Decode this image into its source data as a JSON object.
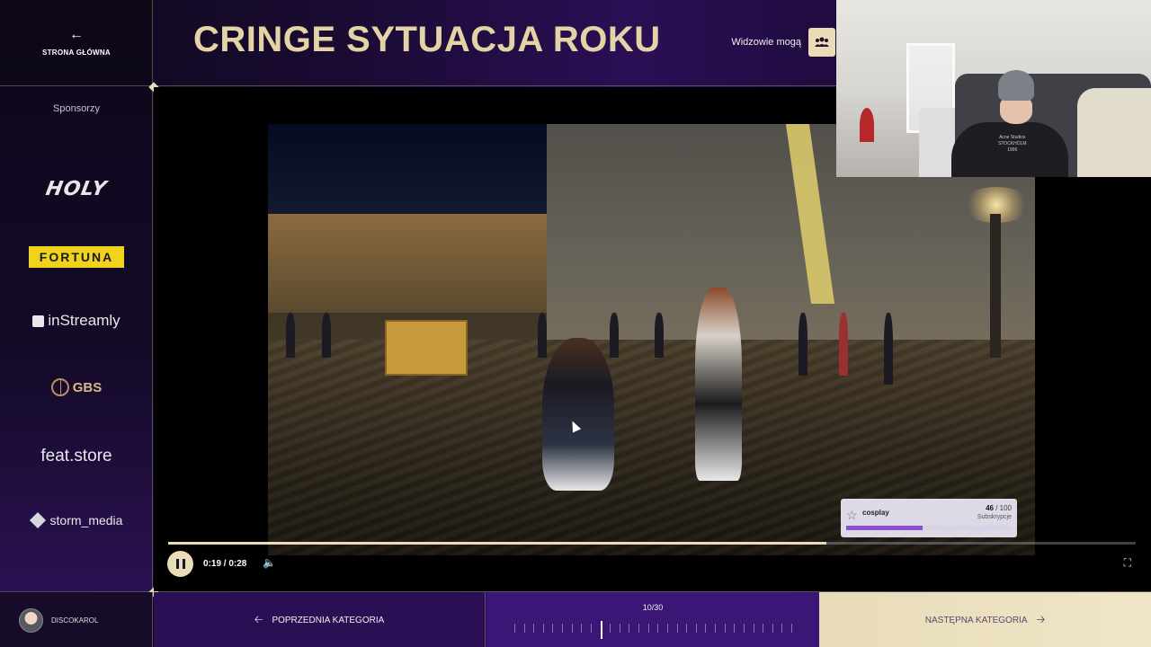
{
  "sidebar": {
    "home_label": "STRONA GŁÓWNA",
    "sponsors_title": "Sponsorzy",
    "sponsors": [
      "HOLY",
      "FORTUNA",
      "inStreamly",
      "GBS",
      "feat.store",
      "storm_media"
    ]
  },
  "header": {
    "title": "CRINGE SYTUACJA ROKU",
    "viewers_label": "Widzowie mogą"
  },
  "player": {
    "time": "0:19 / 0:28",
    "progress": 0.68
  },
  "sub_widget": {
    "name": "cosplay",
    "count": "46",
    "total": "/ 100",
    "label": "Subskrypcje",
    "progress": 0.46
  },
  "webcam": {
    "shirt_text": [
      "Acne Studios",
      "STOCKHOLM",
      "1996"
    ]
  },
  "bottom": {
    "username": "DISCOKAROL",
    "prev_label": "POPRZEDNIA KATEGORIA",
    "next_label": "NASTĘPNA KATEGORIA",
    "category_counter": "10/30",
    "current_index": 10,
    "total": 30
  }
}
